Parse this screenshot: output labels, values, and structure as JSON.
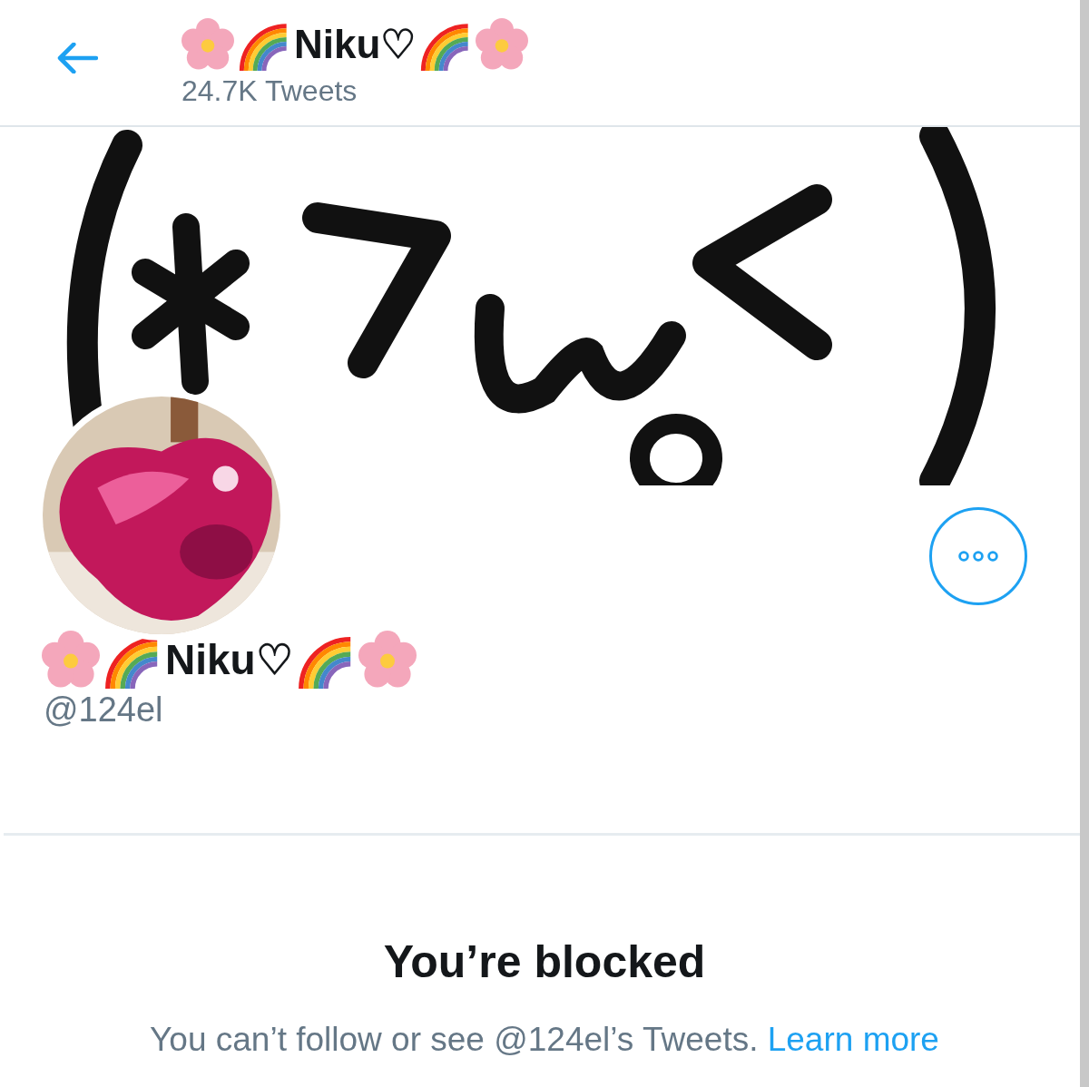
{
  "header": {
    "title": "Niku♡",
    "tweet_count": "24.7K Tweets"
  },
  "profile": {
    "name": "Niku♡",
    "handle": "@124el"
  },
  "blocked": {
    "title": "You’re blocked",
    "message": "You can’t follow or see @124el’s Tweets.",
    "link": "Learn more"
  }
}
